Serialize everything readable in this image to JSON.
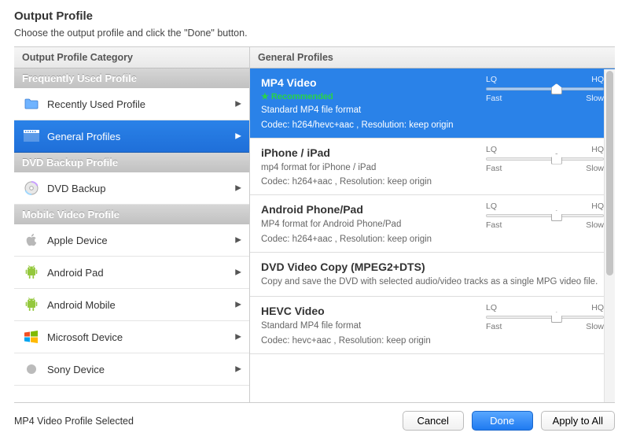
{
  "header": {
    "title": "Output Profile",
    "subtitle": "Choose the output profile and click the \"Done\" button."
  },
  "sidebar": {
    "col_header": "Output Profile Category",
    "groups": [
      {
        "header": "Frequently Used Profile",
        "items": [
          {
            "icon": "folder",
            "label": "Recently Used Profile",
            "selected": false
          },
          {
            "icon": "film",
            "label": "General Profiles",
            "selected": true
          }
        ]
      },
      {
        "header": "DVD Backup Profile",
        "items": [
          {
            "icon": "disc",
            "label": "DVD Backup",
            "selected": false
          }
        ]
      },
      {
        "header": "Mobile Video Profile",
        "items": [
          {
            "icon": "apple",
            "label": "Apple Device",
            "selected": false
          },
          {
            "icon": "android",
            "label": "Android Pad",
            "selected": false
          },
          {
            "icon": "android",
            "label": "Android Mobile",
            "selected": false
          },
          {
            "icon": "windows",
            "label": "Microsoft Device",
            "selected": false
          },
          {
            "icon": "sony",
            "label": "Sony Device",
            "selected": false
          }
        ]
      }
    ]
  },
  "main": {
    "col_header": "General Profiles",
    "slider": {
      "lq": "LQ",
      "hq": "HQ",
      "fast": "Fast",
      "slow": "Slow"
    },
    "profiles": [
      {
        "title": "MP4 Video",
        "recommended": "★ Recommended",
        "desc": "Standard MP4 file format",
        "codec": "Codec: h264/hevc+aac , Resolution: keep origin",
        "slider": true,
        "thumb": 60,
        "selected": true
      },
      {
        "title": "iPhone / iPad",
        "desc": "mp4 format for iPhone / iPad",
        "codec": "Codec: h264+aac , Resolution: keep origin",
        "slider": true,
        "thumb": 60,
        "selected": false
      },
      {
        "title": "Android Phone/Pad",
        "desc": "MP4 format for Android Phone/Pad",
        "codec": "Codec: h264+aac , Resolution: keep origin",
        "slider": true,
        "thumb": 60,
        "selected": false
      },
      {
        "title": "DVD Video Copy (MPEG2+DTS)",
        "desc": "Copy and save the DVD with selected audio/video tracks\n as a single MPG video file.",
        "slider": false,
        "selected": false
      },
      {
        "title": "HEVC Video",
        "desc": "Standard MP4 file format",
        "codec": "Codec: hevc+aac , Resolution: keep origin",
        "slider": true,
        "thumb": 60,
        "selected": false
      }
    ]
  },
  "footer": {
    "status": "MP4 Video Profile Selected",
    "cancel": "Cancel",
    "done": "Done",
    "apply": "Apply to All"
  }
}
